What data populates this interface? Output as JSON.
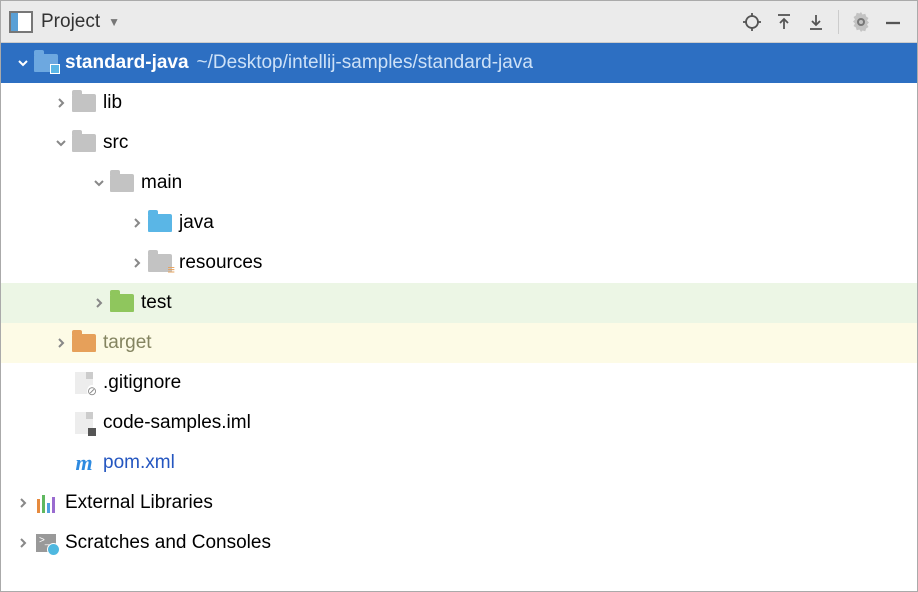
{
  "toolbar": {
    "title": "Project"
  },
  "tree": {
    "root": {
      "name": "standard-java",
      "path": "~/Desktop/intellij-samples/standard-java"
    },
    "lib": "lib",
    "src": "src",
    "main": "main",
    "java": "java",
    "resources": "resources",
    "test": "test",
    "target": "target",
    "gitignore": ".gitignore",
    "iml": "code-samples.iml",
    "pom": "pom.xml",
    "external": "External Libraries",
    "scratches": "Scratches and Consoles"
  }
}
